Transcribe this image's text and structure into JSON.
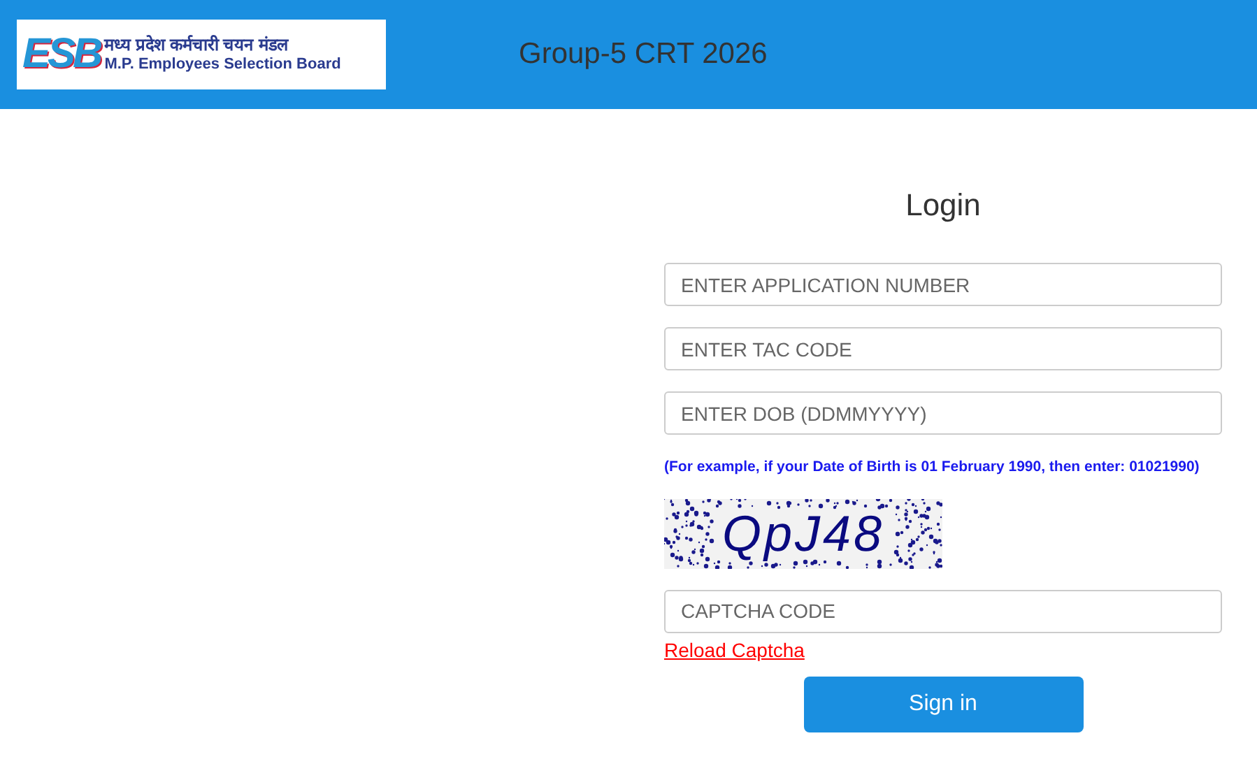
{
  "header": {
    "logo": {
      "mark": "ESB",
      "hindi_name": "मध्य प्रदेश कर्मचारी चयन मंडल",
      "english_name": "M.P. Employees Selection Board"
    },
    "title": "Group-5 CRT 2026"
  },
  "login": {
    "heading": "Login",
    "fields": [
      {
        "placeholder": "ENTER APPLICATION NUMBER"
      },
      {
        "placeholder": "ENTER TAC CODE"
      },
      {
        "placeholder": "ENTER DOB (DDMMYYYY)"
      }
    ],
    "dob_hint": "(For example, if your Date of Birth is 01 February 1990, then enter: 01021990)",
    "captcha_text": "QpJ48",
    "captcha_field": {
      "placeholder": "CAPTCHA CODE"
    },
    "reload_link": "Reload Captcha",
    "submit": "Sign in"
  }
}
